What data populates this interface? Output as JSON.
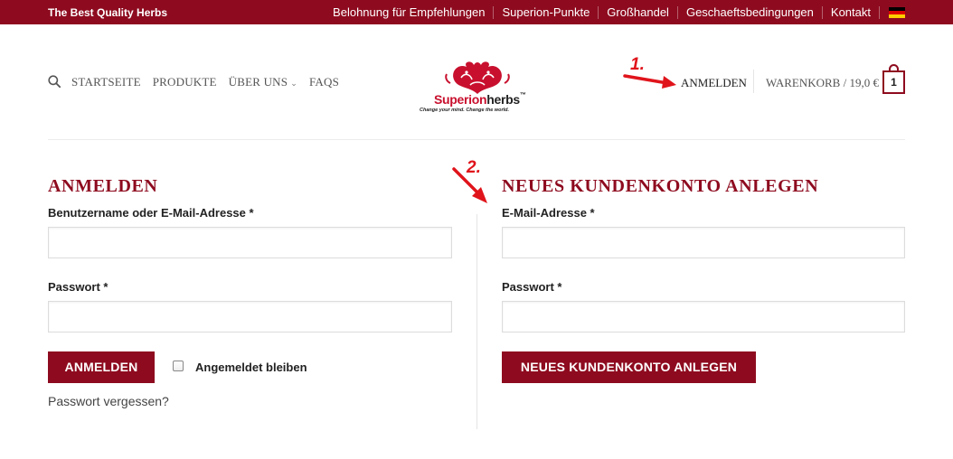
{
  "topbar": {
    "tagline": "The Best Quality Herbs",
    "links": [
      "Belohnung für Empfehlungen",
      "Superion-Punkte",
      "Großhandel",
      "Geschaeftsbedingungen",
      "Kontakt"
    ],
    "flag_icon": "german-flag-icon",
    "colors": {
      "background": "#8e0b1f"
    }
  },
  "header": {
    "search_icon": "search-icon",
    "nav": {
      "home": "STARTSEITE",
      "products": "PRODUKTE",
      "about": "ÜBER UNS",
      "faqs": "FAQS"
    },
    "logo": {
      "brand_part1": "Superion",
      "brand_part2": "herbs",
      "trademark": "™",
      "slogan": "Change your mind. Change the world."
    },
    "account_link": "ANMELDEN",
    "cart": {
      "label": "WARENKORB / 19,0 €",
      "count": "1"
    }
  },
  "annotations": {
    "step1": "1.",
    "step2": "2."
  },
  "login": {
    "title": "ANMELDEN",
    "username_label": "Benutzername oder E-Mail-Adresse *",
    "username_value": "",
    "password_label": "Passwort *",
    "password_value": "",
    "submit_label": "ANMELDEN",
    "remember_label": "Angemeldet bleiben",
    "remember_checked": false,
    "lost_password": "Passwort vergessen?"
  },
  "register": {
    "title": "NEUES KUNDENKONTO ANLEGEN",
    "email_label": "E-Mail-Adresse *",
    "email_value": "",
    "password_label": "Passwort *",
    "password_value": "",
    "submit_label": "NEUES KUNDENKONTO ANLEGEN"
  },
  "colors": {
    "accent": "#8e0b1f",
    "annotation": "#e0141b"
  }
}
